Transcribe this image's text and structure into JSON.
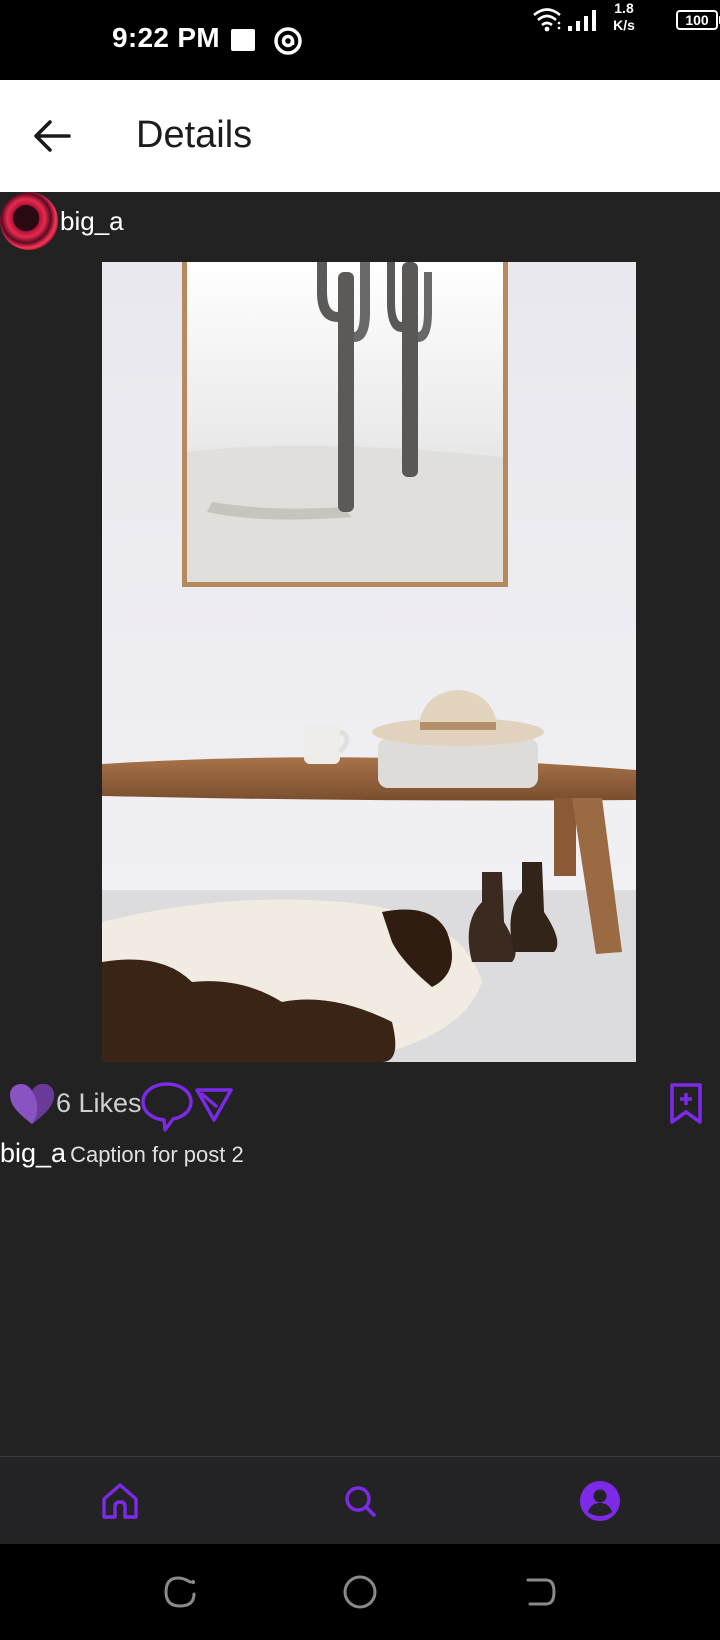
{
  "status_bar": {
    "time": "9:22 PM",
    "net_speed_value": "1.8",
    "net_speed_unit": "K/s",
    "battery": "100"
  },
  "app_bar": {
    "title": "Details",
    "back_icon": "arrow-left-icon"
  },
  "post": {
    "username": "big_a",
    "likes_label": "6 Likes",
    "caption_user": "big_a",
    "caption_text": "Caption for post 2"
  },
  "bottom_nav": {
    "items": [
      "home-icon",
      "search-icon",
      "profile-icon"
    ]
  },
  "colors": {
    "accent": "#7d2ae8",
    "heart_fill": "#8a53c2",
    "content_bg": "#222223",
    "nav_bg": "#232325"
  }
}
